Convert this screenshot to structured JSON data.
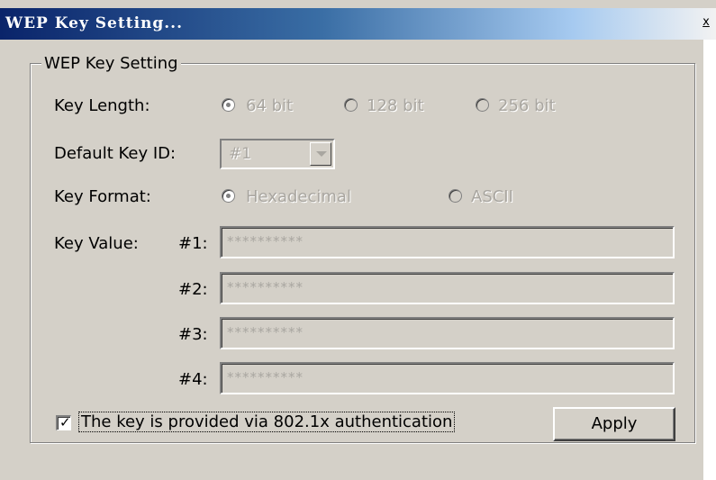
{
  "window": {
    "title": "WEP Key Setting...",
    "close_label": "x"
  },
  "group": {
    "legend": "WEP Key Setting",
    "key_length": {
      "label": "Key Length:",
      "options": [
        "64 bit",
        "128 bit",
        "256 bit"
      ],
      "selected": "64 bit"
    },
    "default_key_id": {
      "label": "Default Key ID:",
      "value": "#1"
    },
    "key_format": {
      "label": "Key Format:",
      "options": [
        "Hexadecimal",
        "ASCII"
      ],
      "selected": "Hexadecimal"
    },
    "key_value": {
      "label": "Key Value:",
      "keys": [
        {
          "id": "#1:",
          "value": "**********"
        },
        {
          "id": "#2:",
          "value": "**********"
        },
        {
          "id": "#3:",
          "value": "**********"
        },
        {
          "id": "#4:",
          "value": "**********"
        }
      ]
    },
    "provided_via_8021x": {
      "label": "The key is provided via 802.1x authentication",
      "checked": true
    },
    "apply_label": "Apply"
  },
  "colors": {
    "dialog_bg": "#d4d0c8",
    "title_gradient_start": "#0a246a",
    "disabled_text": "#a9a6a0"
  }
}
